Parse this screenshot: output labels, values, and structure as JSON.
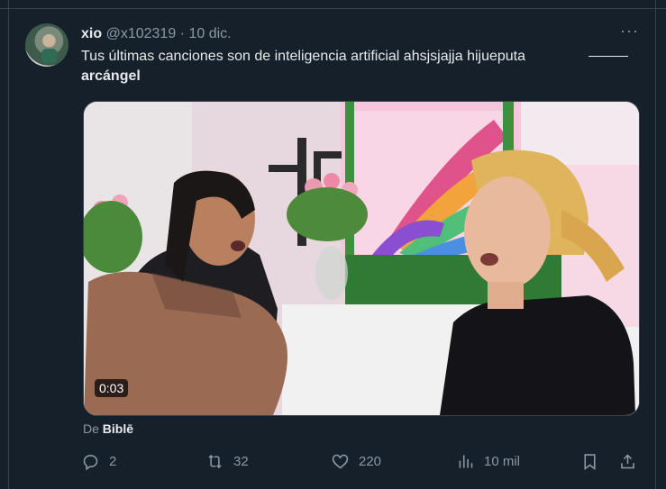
{
  "tweet": {
    "display_name": "xio",
    "handle": "@x102319",
    "separator": "·",
    "date": "10 dic.",
    "more_label": "···",
    "text_main": "Tus últimas canciones son de inteligencia artificial ahsjsjajja hijueputa",
    "text_bold": "arcángel",
    "video_duration": "0:03",
    "from_prefix": "De",
    "from_name": "Biblē"
  },
  "actions": {
    "replies": "2",
    "retweets": "32",
    "likes": "220",
    "views": "10 mil"
  },
  "colors": {
    "background": "#15202b",
    "text": "#e7e9ea",
    "secondary": "#8b98a5",
    "border": "#38444d"
  },
  "icons": [
    "more-icon",
    "reply-icon",
    "retweet-icon",
    "like-icon",
    "views-icon",
    "bookmark-icon",
    "share-icon"
  ]
}
